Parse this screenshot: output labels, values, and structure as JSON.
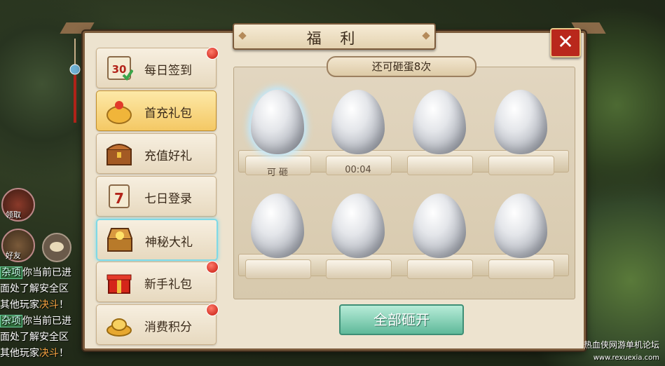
{
  "window": {
    "title": "福 利",
    "close_label": "✕"
  },
  "sidebar": {
    "items": [
      {
        "label": "每日签到",
        "icon": "calendar-30-icon",
        "badge": true,
        "active": false
      },
      {
        "label": "首充礼包",
        "icon": "gold-bag-icon",
        "badge": false,
        "active": true
      },
      {
        "label": "充值好礼",
        "icon": "treasure-chest-icon",
        "badge": false,
        "active": false
      },
      {
        "label": "七日登录",
        "icon": "calendar-7-icon",
        "badge": false,
        "active": false
      },
      {
        "label": "神秘大礼",
        "icon": "open-chest-icon",
        "badge": false,
        "active": false,
        "highlighted": true
      },
      {
        "label": "新手礼包",
        "icon": "gift-box-icon",
        "badge": true,
        "active": false
      },
      {
        "label": "消费积分",
        "icon": "gold-ingot-icon",
        "badge": true,
        "active": false
      }
    ]
  },
  "eggs": {
    "remaining_label": "还可砸蛋8次",
    "row1": [
      {
        "state": "可 砸",
        "glow": true
      },
      {
        "state": "00:04",
        "glow": false
      },
      {
        "state": "",
        "glow": false
      },
      {
        "state": "",
        "glow": false
      }
    ],
    "row2": [
      {
        "state": "",
        "glow": false
      },
      {
        "state": "",
        "glow": false
      },
      {
        "state": "",
        "glow": false
      },
      {
        "state": "",
        "glow": false
      }
    ],
    "open_all_label": "全部砸开"
  },
  "hud": {
    "claim_label": "领取",
    "friend_label": "好友",
    "chat_lines": [
      {
        "tag": "杂项",
        "text": "你当前已进"
      },
      {
        "tag": "",
        "text": "面处了解安全区"
      },
      {
        "tag": "",
        "text": "其他玩家",
        "red": "决斗",
        "end": "！"
      },
      {
        "tag": "杂项",
        "text": "你当前已进"
      },
      {
        "tag": "",
        "text": "面处了解安全区"
      },
      {
        "tag": "",
        "text": "其他玩家",
        "red": "决斗",
        "end": "！"
      }
    ]
  },
  "watermark": {
    "line1": "热血侠网游单机论坛",
    "line2": "www.rexuexia.com"
  },
  "colors": {
    "accent": "#f4c864",
    "close_red": "#b9281c",
    "button_green": "#5fb99a",
    "badge_red": "#c4180e"
  }
}
